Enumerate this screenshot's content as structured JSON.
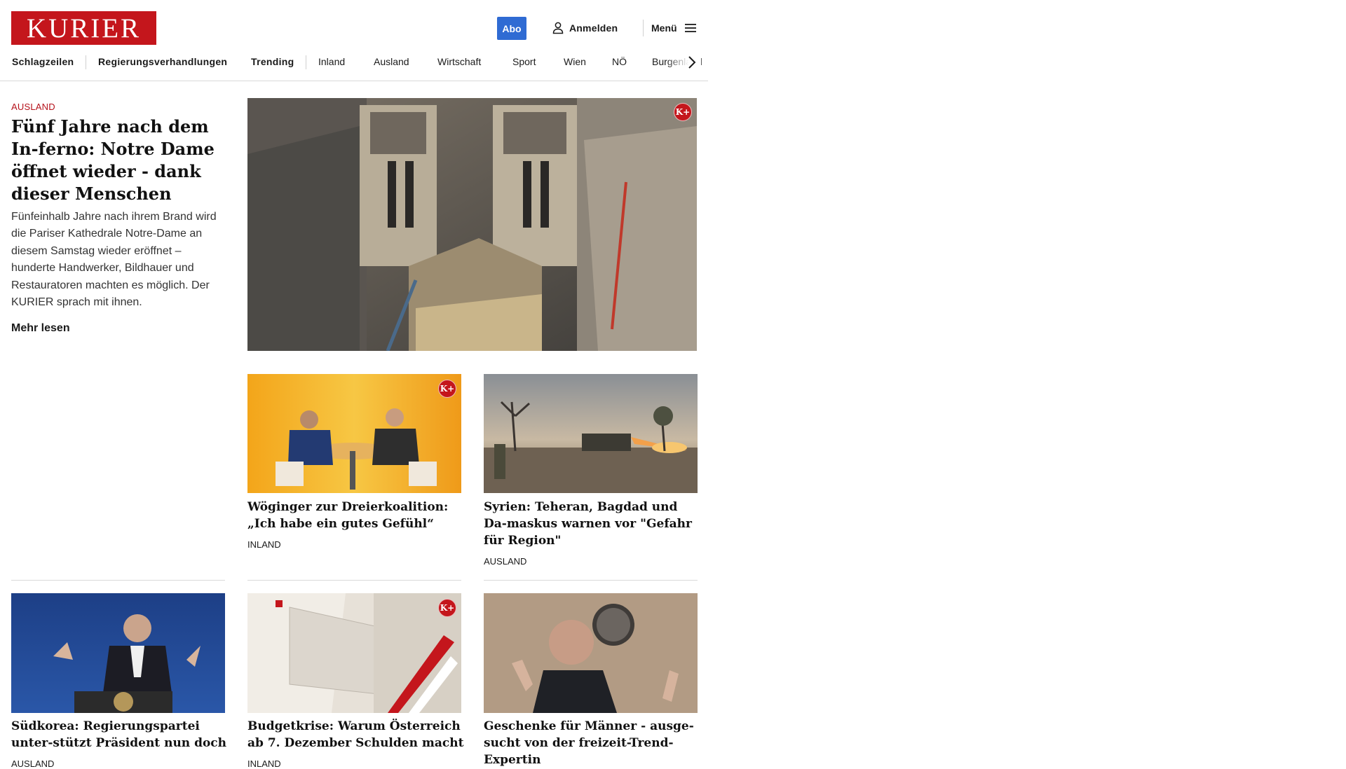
{
  "header": {
    "logo": "KURIER",
    "abo": "Abo",
    "login": "Anmelden",
    "menu": "Menü",
    "nav": [
      "Schlagzeilen",
      "Regierungsverhandlungen",
      "Trending",
      "Inland",
      "Ausland",
      "Wirtschaft",
      "Sport",
      "Wien",
      "NÖ",
      "Burgenland"
    ]
  },
  "lead": {
    "category": "AUSLAND",
    "title": "Fünf Jahre nach dem In-ferno: Notre Dame öffnet wieder - dank dieser Menschen",
    "teaser": "Fünfeinhalb Jahre nach ihrem Brand wird die Pariser Kathedrale Notre-Dame an diesem Samstag wieder eröffnet – hunderte Handwerker, Bildhauer und Restauratoren machten es möglich. Der KURIER sprach mit ihnen.",
    "more": "Mehr lesen",
    "badge": "K+"
  },
  "cards": [
    {
      "title": "Wöginger zur Dreierkoalition: „Ich habe ein gutes Gefühl“",
      "category": "INLAND",
      "badge": "K+"
    },
    {
      "title": "Syrien: Teheran, Bagdad und Da-maskus warnen vor \"Gefahr für Region\"",
      "category": "AUSLAND"
    },
    {
      "title": "Südkorea: Regierungspartei unter-stützt Präsident nun doch",
      "category": "AUSLAND"
    },
    {
      "title": "Budgetkrise: Warum Österreich ab 7. Dezember Schulden macht",
      "category": "INLAND",
      "badge": "K+"
    },
    {
      "title": "Geschenke für Männer - ausge-sucht von der freizeit-Trend-Expertin",
      "category": ""
    }
  ],
  "colors": {
    "brand": "#c4161c",
    "abo": "#2f6bd3",
    "kicker": "#b5121b"
  }
}
